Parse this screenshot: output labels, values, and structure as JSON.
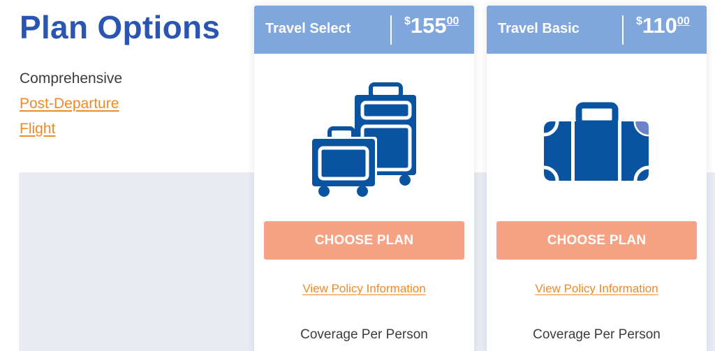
{
  "page": {
    "title": "Plan Options",
    "options": [
      {
        "label": "Comprehensive"
      },
      {
        "label": "Post-Departure"
      },
      {
        "label": "Flight"
      }
    ]
  },
  "colors": {
    "title": "#2a55b0",
    "link": "#f08a24",
    "card_header": "#7fa6dd",
    "button": "#f6a385",
    "icon": "#0a53a1",
    "panel": "#eaecf4"
  },
  "plans": [
    {
      "name": "Travel Select",
      "currency": "$",
      "price_whole": "155",
      "price_cents": "00",
      "icon": "luggage-set-icon",
      "choose_label": "CHOOSE PLAN",
      "policy_label": "View Policy Information",
      "coverage_label": "Coverage Per Person"
    },
    {
      "name": "Travel Basic",
      "currency": "$",
      "price_whole": "110",
      "price_cents": "00",
      "icon": "suitcase-icon",
      "choose_label": "CHOOSE PLAN",
      "policy_label": "View Policy Information",
      "coverage_label": "Coverage Per Person"
    }
  ]
}
